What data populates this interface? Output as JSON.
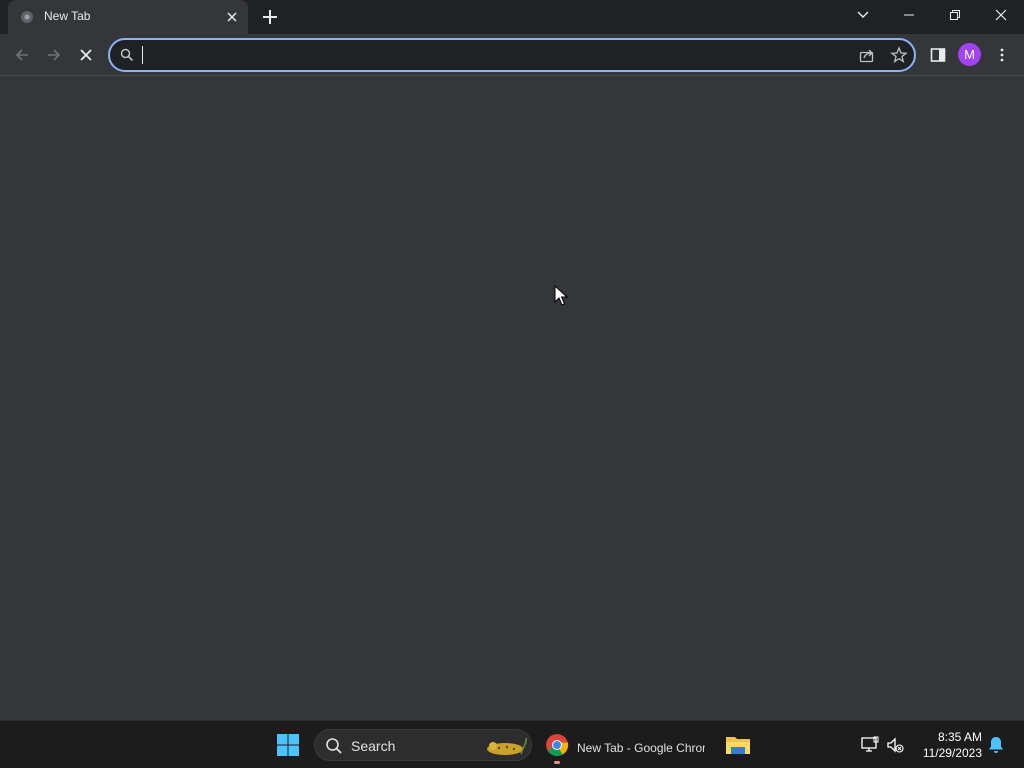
{
  "window": {
    "tab_title": "New Tab",
    "controls": {
      "tab_search_icon": "chevron-down-icon",
      "minimize_icon": "minimize-icon",
      "restore_icon": "restore-icon",
      "close_icon": "close-icon"
    }
  },
  "toolbar": {
    "back_icon": "arrow-left-icon",
    "forward_icon": "arrow-right-icon",
    "stop_icon": "close-icon",
    "omnibox": {
      "value": "",
      "placeholder": ""
    },
    "avatar_letter": "M",
    "colors": {
      "accent": "#8ab4f8",
      "avatar": "#a142f4",
      "background": "#35363a",
      "titlebar": "#202124"
    }
  },
  "taskbar": {
    "search_label": "Search",
    "chrome_label": "New Tab - Google Chrome",
    "clock_time": "8:35 AM",
    "clock_date": "11/29/2023",
    "colors": {
      "background": "#1c1c1c",
      "start_blue": "#4cc2ff",
      "notify": "#4cc2ff"
    }
  }
}
